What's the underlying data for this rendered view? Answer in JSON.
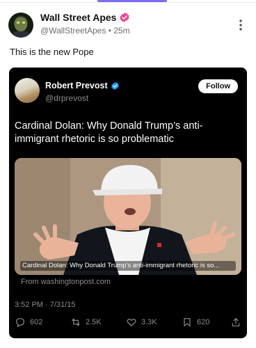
{
  "post": {
    "author_name": "Wall Street Apes",
    "author_handle": "@WallStreetApes",
    "separator": "•",
    "time_ago": "25m",
    "text": "This is the new Pope"
  },
  "embedded": {
    "author_name": "Robert Prevost",
    "author_handle": "@drprevost",
    "follow_label": "Follow",
    "text": "Cardinal Dolan: Why Donald Trump’s anti-immigrant rhetoric is so problematic",
    "link_caption": "Cardinal Dolan: Why Donald Trump’s anti-immigrant rhetoric is so...",
    "from_label": "From washingtonpost.com",
    "timestamp": "3:52 PM · 7/31/15",
    "stats": {
      "replies": "602",
      "reposts": "2.5K",
      "likes": "3.3K",
      "views": "620"
    }
  },
  "icons": {
    "verified_main": "verified-badge-pink",
    "verified_embedded": "verified-badge-blue",
    "more": "more-vertical",
    "reply": "speech-bubble",
    "repost": "repost-arrows",
    "like": "heart",
    "views": "bookmark",
    "share": "share-up-arrow"
  },
  "colors": {
    "accent": "#7c6cf2",
    "verified_pink": "#e8478f",
    "verified_blue": "#1d9bf0",
    "card_background": "#000000",
    "muted_text": "#8b8b8b"
  }
}
